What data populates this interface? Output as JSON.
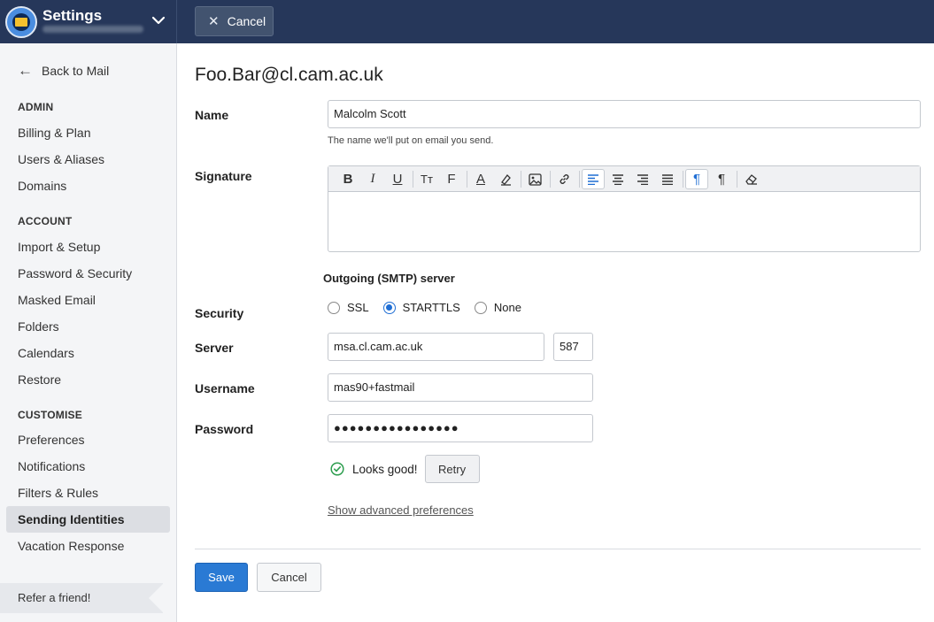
{
  "header": {
    "app_title": "Settings",
    "cancel_label": "Cancel"
  },
  "sidebar": {
    "back_label": "Back to Mail",
    "sections": [
      {
        "title": "ADMIN",
        "items": [
          "Billing & Plan",
          "Users & Aliases",
          "Domains"
        ]
      },
      {
        "title": "ACCOUNT",
        "items": [
          "Import & Setup",
          "Password & Security",
          "Masked Email",
          "Folders",
          "Calendars",
          "Restore"
        ]
      },
      {
        "title": "CUSTOMISE",
        "items": [
          "Preferences",
          "Notifications",
          "Filters & Rules",
          "Sending Identities",
          "Vacation Response"
        ]
      }
    ],
    "active_item": "Sending Identities",
    "refer_label": "Refer a friend!"
  },
  "main": {
    "title": "Foo.Bar@cl.cam.ac.uk",
    "name_label": "Name",
    "name_value": "Malcolm Scott",
    "name_hint": "The name we'll put on email you send.",
    "signature_label": "Signature",
    "smtp_heading": "Outgoing (SMTP) server",
    "security_label": "Security",
    "security_options": [
      "SSL",
      "STARTTLS",
      "None"
    ],
    "security_selected": "STARTTLS",
    "server_label": "Server",
    "server_value": "msa.cl.cam.ac.uk",
    "port_value": "587",
    "username_label": "Username",
    "username_value": "mas90+fastmail",
    "password_label": "Password",
    "password_value": "●●●●●●●●●●●●●●●●",
    "status_text": "Looks good!",
    "retry_label": "Retry",
    "advanced_link": "Show advanced preferences",
    "save_label": "Save",
    "cancel_label": "Cancel"
  },
  "colors": {
    "topbar": "#26375a",
    "primary": "#2a7ad4",
    "success": "#2e9e4f"
  }
}
